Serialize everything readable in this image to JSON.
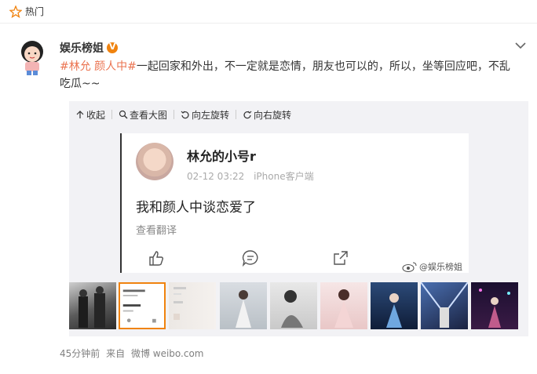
{
  "topbar": {
    "label": "热门",
    "icon": "star-icon"
  },
  "post": {
    "author": "娱乐榜姐",
    "verified_badge": "V",
    "tags": [
      "#林允 颜人中#"
    ],
    "text_after_tag": "一起回家和外出，不一定就是恋情，朋友也可以的，所以，坐等回应吧，不乱吃瓜~~",
    "time": "45分钟前",
    "source_prefix": "来自",
    "source": "微博 weibo.com"
  },
  "media_toolbar": {
    "collapse": "收起",
    "view_large": "查看大图",
    "rotate_left": "向左旋转",
    "rotate_right": "向右旋转"
  },
  "big_image": {
    "name": "林允的小号r",
    "date": "02-12 03:22",
    "client": "iPhone客户端",
    "content": "我和颜人中谈恋爱了",
    "translate": "查看翻译",
    "watermark": "@娱乐榜姐"
  },
  "colors": {
    "tag": "#eb7350",
    "badge": "#f0830f",
    "selected_border": "#f0830f",
    "meta": "#808080"
  }
}
